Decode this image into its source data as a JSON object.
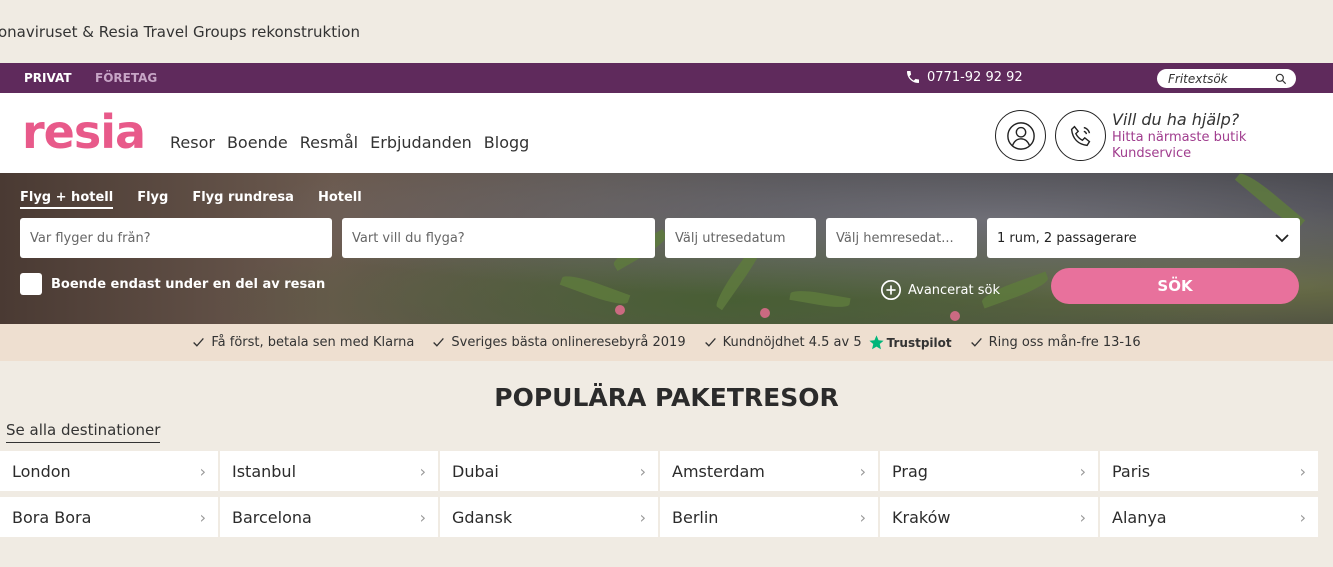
{
  "banner": {
    "text": "onaviruset & Resia Travel Groups rekonstruktion"
  },
  "topbar": {
    "segments": [
      "PRIVAT",
      "FÖRETAG"
    ],
    "phone": "0771-92 92 92",
    "search_label": "Fritextsök"
  },
  "header": {
    "logo": "resia",
    "nav": [
      "Resor",
      "Boende",
      "Resmål",
      "Erbjudanden",
      "Blogg"
    ],
    "help_title": "Vill du ha hjälp?",
    "help_links": [
      "Hitta närmaste butik",
      "Kundservice"
    ]
  },
  "search": {
    "tabs": [
      "Flyg + hotell",
      "Flyg",
      "Flyg rundresa",
      "Hotell"
    ],
    "from_placeholder": "Var flyger du från?",
    "to_placeholder": "Vart vill du flyga?",
    "out_placeholder": "Välj utresedatum",
    "home_placeholder": "Välj hemresedat...",
    "passengers": "1 rum, 2 passagerare",
    "partial_stay": "Boende endast under en del av resan",
    "advanced": "Avancerat sök",
    "submit": "SÖK"
  },
  "usps": [
    "Få först, betala sen med Klarna",
    "Sveriges bästa onlineresebyrå 2019",
    "Kundnöjdhet 4.5 av 5",
    "Ring oss mån-fre 13-16"
  ],
  "trustpilot": "Trustpilot",
  "popular": {
    "title": "POPULÄRA PAKETRESOR",
    "see_all": "Se alla destinationer",
    "rows": [
      [
        "London",
        "Istanbul",
        "Dubai",
        "Amsterdam",
        "Prag",
        "Paris"
      ],
      [
        "Bora Bora",
        "Barcelona",
        "Gdansk",
        "Berlin",
        "Kraków",
        "Alanya"
      ]
    ]
  },
  "colors": {
    "brand_purple": "#5f2a5c",
    "brand_pink": "#e85a8a",
    "button_pink": "#e8719c",
    "usp_bg": "#eedfd0",
    "trustpilot_green": "#00b67a"
  }
}
